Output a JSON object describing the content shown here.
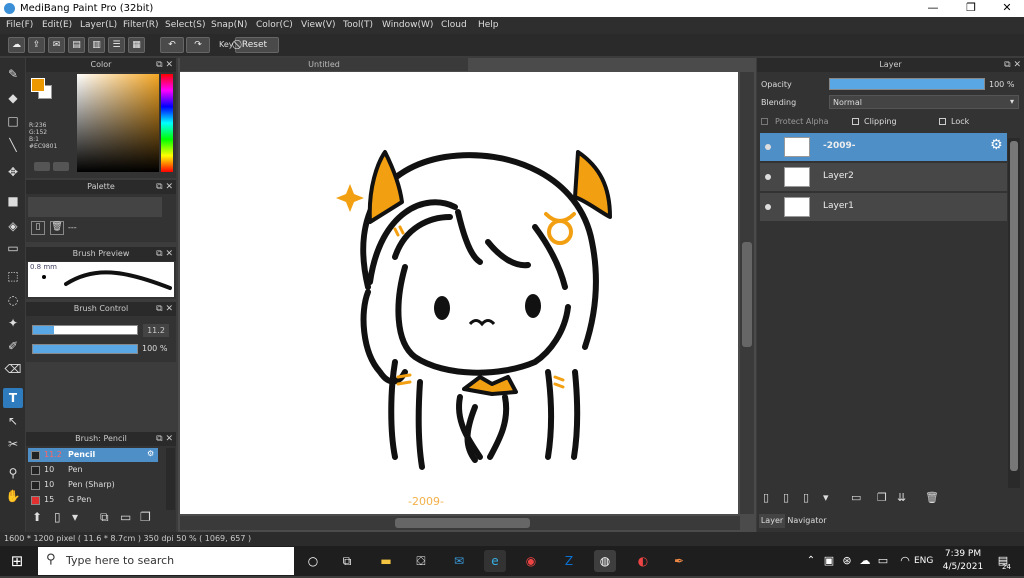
{
  "window": {
    "title": "MediBang Paint Pro (32bit)"
  },
  "menu": [
    "File(F)",
    "Edit(E)",
    "Layer(L)",
    "Filter(R)",
    "Select(S)",
    "Snap(N)",
    "Color(C)",
    "View(V)",
    "Tool(T)",
    "Window(W)",
    "Cloud",
    "Help"
  ],
  "toolbar": {
    "key_label": "Key",
    "reset_label": "Reset"
  },
  "color_panel": {
    "title": "Color",
    "r": "R:236",
    "g": "G:152",
    "b": "B:1",
    "hex": "#EC9801",
    "fg": "#EC9801"
  },
  "palette_panel": {
    "title": "Palette",
    "dash": "---"
  },
  "brush_preview": {
    "title": "Brush Preview",
    "size": "0.8 mm"
  },
  "brush_control": {
    "title": "Brush Control",
    "size_value": "11.2",
    "opacity_value": "100 %"
  },
  "brush_list": {
    "title": "Brush: Pencil",
    "items": [
      {
        "size": "11.2",
        "name": "Pencil",
        "color": "#222222",
        "selected": true
      },
      {
        "size": "10",
        "name": "Pen",
        "color": "#222222"
      },
      {
        "size": "10",
        "name": "Pen (Sharp)",
        "color": "#222222"
      },
      {
        "size": "15",
        "name": "G Pen",
        "color": "#e03030"
      }
    ]
  },
  "canvas": {
    "tab": "Untitled",
    "signature": "-2009-"
  },
  "layer_panel": {
    "title": "Layer",
    "opacity_label": "Opacity",
    "opacity_value": "100 %",
    "blending_label": "Blending",
    "blending_value": "Normal",
    "protect_alpha": "Protect Alpha",
    "clipping": "Clipping",
    "lock": "Lock",
    "layers": [
      {
        "name": "-2009-",
        "selected": true
      },
      {
        "name": "Layer2"
      },
      {
        "name": "Layer1"
      }
    ],
    "tabs": [
      "Layer",
      "Navigator"
    ]
  },
  "status": {
    "text": "1600 * 1200 pixel  ( 11.6 * 8.7cm )  350 dpi  50 %  ( 1069, 657 )"
  },
  "taskbar": {
    "search_placeholder": "Type here to search",
    "lang": "ENG",
    "time": "7:39 PM",
    "date": "4/5/2021",
    "notif_count": "24"
  }
}
